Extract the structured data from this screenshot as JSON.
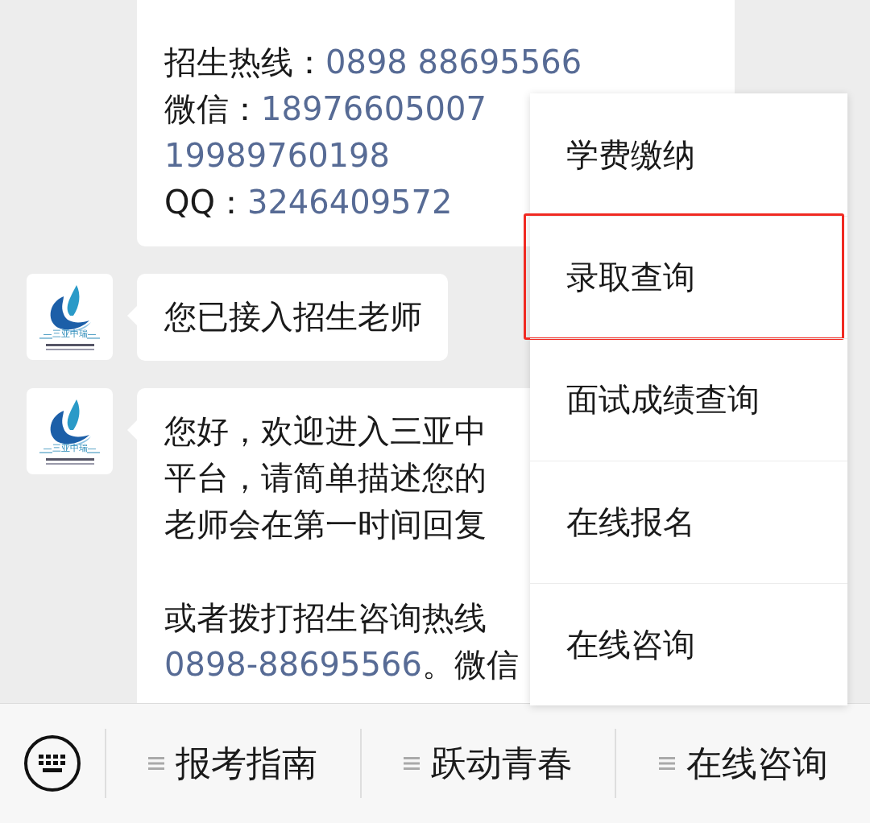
{
  "messages": [
    {
      "avatar": false,
      "cut_top": true,
      "paragraphs": [
        [
          [
            {
              "text": "招生热线：",
              "link": false
            },
            {
              "text": "0898 88695566",
              "link": true
            }
          ],
          [
            {
              "text": "微信：",
              "link": false
            },
            {
              "text": "18976605007",
              "link": true
            }
          ],
          [
            {
              "text": "19989760198",
              "link": true
            }
          ],
          [
            {
              "text": "QQ：",
              "link": false
            },
            {
              "text": "3246409572",
              "link": true
            }
          ]
        ]
      ]
    },
    {
      "avatar": true,
      "logo_text": "—三亚中瑞—",
      "cut_top": false,
      "paragraphs": [
        [
          [
            {
              "text": "您已接入招生老师",
              "link": false
            }
          ]
        ]
      ]
    },
    {
      "avatar": true,
      "logo_text": "—三亚中瑞—",
      "cut_top": false,
      "paragraphs": [
        [
          [
            {
              "text": "您好，欢迎进入三亚中",
              "link": false
            }
          ],
          [
            {
              "text": "平台，请简单描述您的",
              "link": false
            }
          ],
          [
            {
              "text": "老师会在第一时间回复",
              "link": false
            }
          ]
        ],
        [
          [
            {
              "text": "或者拨打招生咨询热线",
              "link": false
            }
          ],
          [
            {
              "text": "0898-88695566",
              "link": true
            },
            {
              "text": "。微信",
              "link": false
            }
          ]
        ]
      ]
    }
  ],
  "popup_menu": [
    {
      "label": "学费缴纳",
      "highlighted": false
    },
    {
      "label": "录取查询",
      "highlighted": true
    },
    {
      "label": "面试成绩查询",
      "highlighted": false
    },
    {
      "label": "在线报名",
      "highlighted": false
    },
    {
      "label": "在线咨询",
      "highlighted": false
    }
  ],
  "bottom_menu": [
    {
      "label": "报考指南"
    },
    {
      "label": "跃动青春"
    },
    {
      "label": "在线咨询"
    }
  ]
}
